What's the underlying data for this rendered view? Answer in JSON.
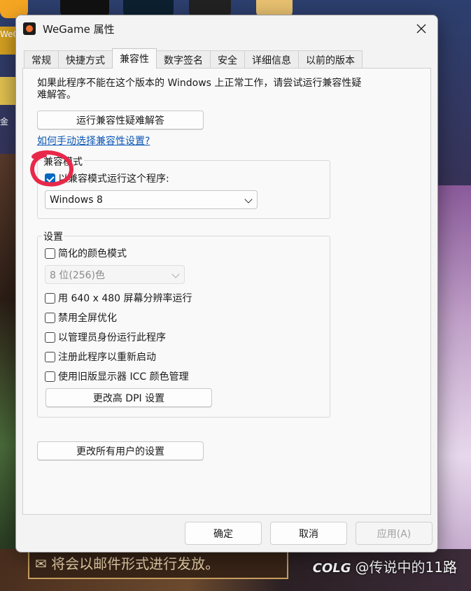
{
  "window": {
    "title": "WeGame 属性"
  },
  "tabs": [
    {
      "label": "常规"
    },
    {
      "label": "快捷方式"
    },
    {
      "label": "兼容性",
      "active": true
    },
    {
      "label": "数字签名"
    },
    {
      "label": "安全"
    },
    {
      "label": "详细信息"
    },
    {
      "label": "以前的版本"
    }
  ],
  "compat": {
    "intro": "如果此程序不能在这个版本的 Windows 上正常工作，请尝试运行兼容性疑难解答。",
    "troubleshoot_button": "运行兼容性疑难解答",
    "manual_link": "如何手动选择兼容性设置?",
    "mode_group_title": "兼容模式",
    "mode_checkbox_label": "以兼容模式运行这个程序:",
    "mode_checked": true,
    "mode_select_value": "Windows 8"
  },
  "settings": {
    "group_title": "设置",
    "reduced_color_label": "简化的颜色模式",
    "color_select_value": "8 位(256)色",
    "res_label": "用 640 x 480 屏幕分辨率运行",
    "fullscreen_label": "禁用全屏优化",
    "admin_label": "以管理员身份运行此程序",
    "register_restart_label": "注册此程序以重新启动",
    "icc_label": "使用旧版显示器 ICC 颜色管理",
    "dpi_button": "更改高 DPI 设置"
  },
  "all_users_button": "更改所有用户的设置",
  "footer": {
    "ok": "确定",
    "cancel": "取消",
    "apply": "应用(A)"
  },
  "background": {
    "banner_text": "将会以邮件形式进行发放。",
    "watermark_logo": "COLG",
    "watermark_text": "@传说中的11路",
    "left_label_1": "WeG",
    "left_label_2": "金"
  },
  "colors": {
    "accent": "#0067c0",
    "link": "#0b57b5",
    "annotation": "#e8284a"
  }
}
